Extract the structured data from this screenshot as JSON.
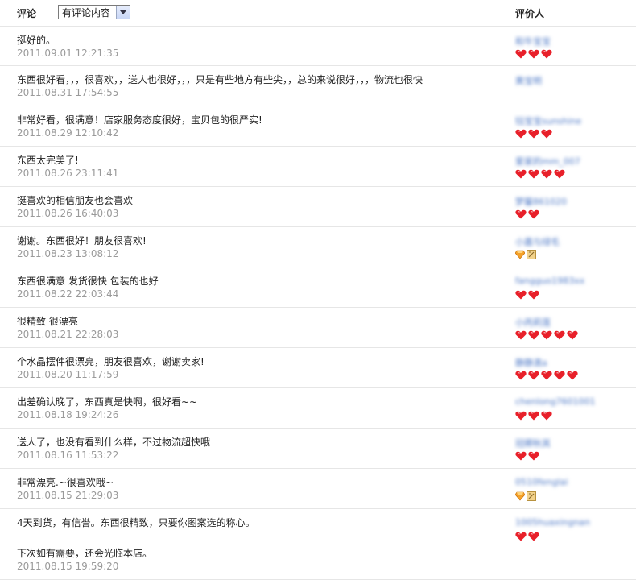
{
  "header": {
    "comment_label": "评论",
    "filter_selected": "有评论内容",
    "rater_label": "评价人"
  },
  "rows": [
    {
      "comment": "挺好的。",
      "time": "2011.09.01 12:21:35",
      "rater": "和牛宝宝",
      "badge": {
        "type": "hearts",
        "count": 3
      }
    },
    {
      "comment": "东西很好看，，，很喜欢，，送人也很好，，，只是有些地方有些尖，，总的来说很好，，，物流也很快",
      "time": "2011.08.31 17:54:55",
      "rater": "黄宝明",
      "badge": {
        "type": "none",
        "count": 0
      }
    },
    {
      "comment": "非常好看，很满意！店家服务态度很好，宝贝包的很严实!",
      "time": "2011.08.29 12:10:42",
      "rater": "钰宝宝sunshine",
      "badge": {
        "type": "hearts",
        "count": 3
      }
    },
    {
      "comment": "东西太完美了!",
      "time": "2011.08.26 23:11:41",
      "rater": "爱家的mm_007",
      "badge": {
        "type": "hearts",
        "count": 4
      }
    },
    {
      "comment": "挺喜欢的相信朋友也会喜欢",
      "time": "2011.08.26 16:40:03",
      "rater": "梦馨861020",
      "badge": {
        "type": "hearts",
        "count": 2
      }
    },
    {
      "comment": "谢谢。东西很好！朋友很喜欢!",
      "time": "2011.08.23 13:08:12",
      "rater": "小嘉与绿毛",
      "badge": {
        "type": "diamond-box",
        "count": 2
      }
    },
    {
      "comment": "东西很满意 发货很快 包装的也好",
      "time": "2011.08.22 22:03:44",
      "rater": "fangguo1983xx",
      "badge": {
        "type": "hearts",
        "count": 2
      }
    },
    {
      "comment": "很精致 很漂亮",
      "time": "2011.08.21 22:28:03",
      "rater": "小丙莉莲",
      "badge": {
        "type": "hearts",
        "count": 5
      }
    },
    {
      "comment": "个水晶摆件很漂亮，朋友很喜欢，谢谢卖家!",
      "time": "2011.08.20 11:17:59",
      "rater": "静静滴a",
      "badge": {
        "type": "hearts",
        "count": 5
      }
    },
    {
      "comment": "出差确认晚了，东西真是快啊，很好看~~",
      "time": "2011.08.18 19:24:26",
      "rater": "chenlong7601001",
      "badge": {
        "type": "hearts",
        "count": 3
      }
    },
    {
      "comment": "送人了，也没有看到什么样，不过物流超快哦",
      "time": "2011.08.16 11:53:22",
      "rater": "冠卿秋其",
      "badge": {
        "type": "hearts",
        "count": 2
      }
    },
    {
      "comment": "非常漂亮.~很喜欢哦~",
      "time": "2011.08.15 21:29:03",
      "rater": "0510fenglai",
      "badge": {
        "type": "diamond-box",
        "count": 2
      }
    },
    {
      "comment": "4天到货，有信誉。东西很精致，只要你图案选的称心。",
      "comment2": "下次如有需要，还会光临本店。",
      "time": "2011.08.15 19:59:20",
      "rater": "1005huaxingnan",
      "badge": {
        "type": "hearts",
        "count": 2
      }
    }
  ],
  "colors": {
    "heart": "#e8202a",
    "rater": "#4e79c6",
    "time": "#9a9a9a",
    "divider": "#e6e6e6"
  }
}
